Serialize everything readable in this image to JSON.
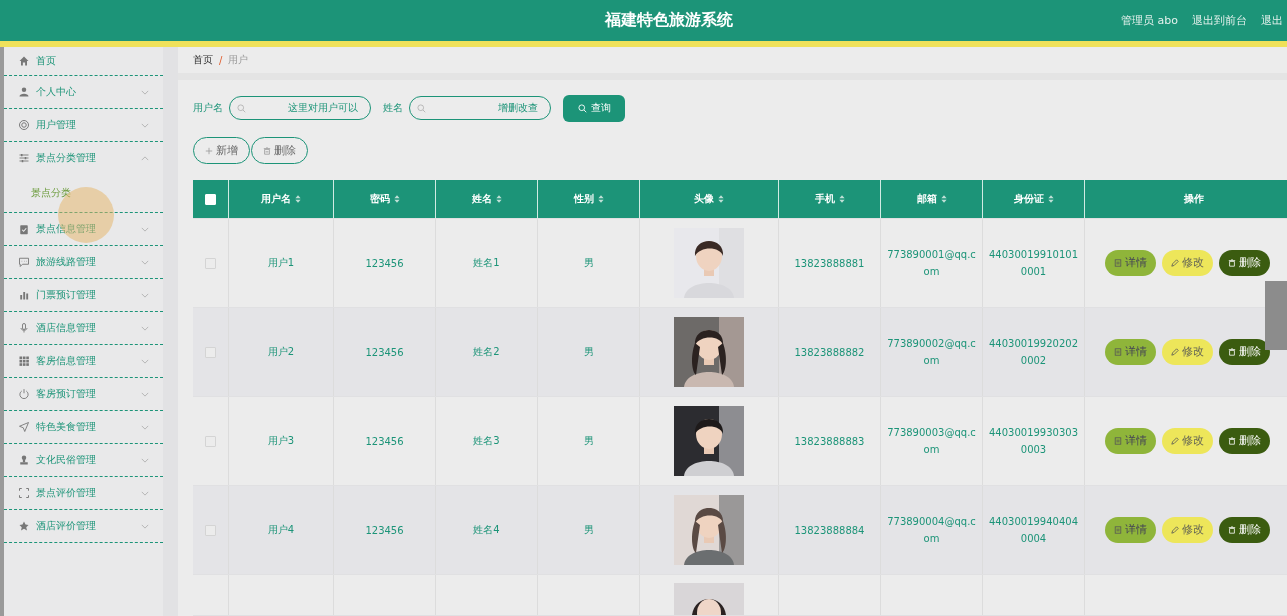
{
  "header": {
    "title": "福建特色旅游系统",
    "links": [
      "管理员 abo",
      "退出到前台",
      "退出"
    ]
  },
  "sidebar": {
    "items": [
      {
        "label": "首页"
      },
      {
        "label": "个人中心",
        "expanded": false
      },
      {
        "label": "用户管理",
        "expanded": false
      },
      {
        "label": "景点分类管理",
        "expanded": true,
        "children": [
          {
            "label": "景点分类"
          }
        ]
      },
      {
        "label": "景点信息管理",
        "expanded": false
      },
      {
        "label": "旅游线路管理",
        "expanded": false
      },
      {
        "label": "门票预订管理",
        "expanded": false
      },
      {
        "label": "酒店信息管理",
        "expanded": false
      },
      {
        "label": "客房信息管理",
        "expanded": false
      },
      {
        "label": "客房预订管理",
        "expanded": false
      },
      {
        "label": "特色美食管理",
        "expanded": false
      },
      {
        "label": "文化民俗管理",
        "expanded": false
      },
      {
        "label": "景点评价管理",
        "expanded": false
      },
      {
        "label": "酒店评价管理",
        "expanded": false
      }
    ]
  },
  "breadcrumb": {
    "items": [
      "首页",
      "用户"
    ],
    "separator": "/"
  },
  "search": {
    "fields": [
      {
        "label": "用户名",
        "value": "这里对用户可以"
      },
      {
        "label": "姓名",
        "value": "增删改查"
      }
    ],
    "button": "查询"
  },
  "actions": [
    "新增",
    "删除"
  ],
  "table": {
    "select_all": {
      "checked": false
    },
    "columns": [
      "用户名",
      "密码",
      "姓名",
      "性别",
      "头像",
      "手机",
      "邮箱",
      "身份证",
      "操作"
    ],
    "rows": [
      {
        "checked": false,
        "cells": [
          "用户1",
          "123456",
          "姓名1",
          "男"
        ],
        "photo": {
          "kind": "picture"
        },
        "phone": "13823888881",
        "email": "773890001@qq.com",
        "id_card": "440300199101010001",
        "buttons": [
          "详情",
          "修改",
          "删除"
        ]
      },
      {
        "checked": false,
        "cells": [
          "用户2",
          "123456",
          "姓名2",
          "男"
        ],
        "photo": {
          "kind": "picture"
        },
        "phone": "13823888882",
        "email": "773890002@qq.com",
        "id_card": "440300199202020002",
        "buttons": [
          "详情",
          "修改",
          "删除"
        ]
      },
      {
        "checked": false,
        "cells": [
          "用户3",
          "123456",
          "姓名3",
          "男"
        ],
        "photo": {
          "kind": "picture"
        },
        "phone": "13823888883",
        "email": "773890003@qq.com",
        "id_card": "440300199303030003",
        "buttons": [
          "详情",
          "修改",
          "删除"
        ]
      },
      {
        "checked": false,
        "cells": [
          "用户4",
          "123456",
          "姓名4",
          "男"
        ],
        "photo": {
          "kind": "picture"
        },
        "phone": "13823888884",
        "email": "773890004@qq.com",
        "id_card": "440300199404040004",
        "buttons": [
          "详情",
          "修改",
          "删除"
        ]
      }
    ]
  }
}
